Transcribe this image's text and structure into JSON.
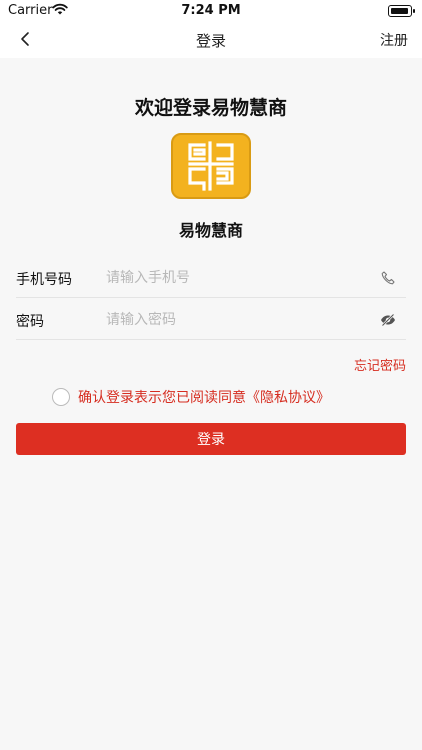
{
  "status_bar": {
    "carrier": "Carrier",
    "time": "7:24 PM"
  },
  "nav": {
    "title": "登录",
    "register": "注册",
    "back_icon": "chevron-left-icon"
  },
  "welcome": "欢迎登录易物慧商",
  "brand_name": "易物慧商",
  "form": {
    "phone": {
      "label": "手机号码",
      "placeholder": "请输入手机号",
      "icon": "phone-icon"
    },
    "password": {
      "label": "密码",
      "placeholder": "请输入密码",
      "icon": "eye-slash-icon"
    }
  },
  "forgot_password": "忘记密码",
  "agreement": "确认登录表示您已阅读同意《隐私协议》",
  "login_button": "登录",
  "colors": {
    "accent": "#dd2f22",
    "logo": "#f3b21f",
    "background": "#f7f7f7"
  }
}
